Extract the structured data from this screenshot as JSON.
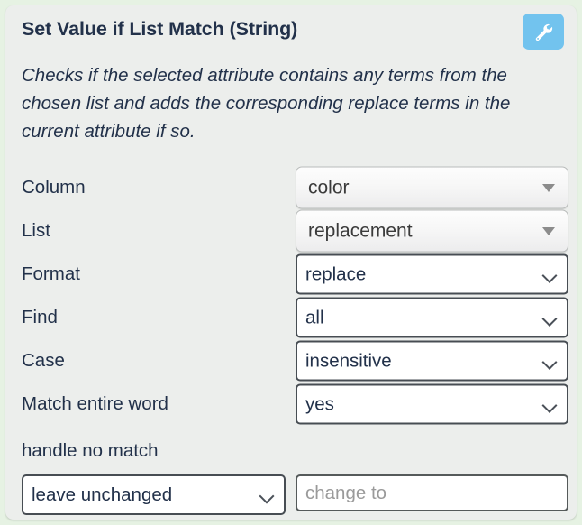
{
  "card": {
    "title": "Set Value if List Match (String)",
    "description": "Checks if the selected attribute contains any terms from the chosen list and adds the corresponding replace terms in the current attribute if so.",
    "badge_icon": "wrench-icon",
    "accent_color": "#72c3ee",
    "background_color": "#eceeec",
    "page_background_color": "#e6f2e3",
    "text_color": "#22314a"
  },
  "form": {
    "rows": [
      {
        "label": "Column",
        "value": "color",
        "control": "combo",
        "icon": "triangle-down-icon"
      },
      {
        "label": "List",
        "value": "replacement",
        "control": "combo",
        "icon": "triangle-down-icon"
      },
      {
        "label": "Format",
        "value": "replace",
        "control": "select",
        "icon": "chevron-down-icon"
      },
      {
        "label": "Find",
        "value": "all",
        "control": "select",
        "icon": "chevron-down-icon"
      },
      {
        "label": "Case",
        "value": "insensitive",
        "control": "select",
        "icon": "chevron-down-icon"
      },
      {
        "label": "Match entire word",
        "value": "yes",
        "control": "select",
        "icon": "chevron-down-icon"
      }
    ]
  },
  "no_match": {
    "label": "handle no match",
    "action_value": "leave unchanged",
    "action_icon": "chevron-down-icon",
    "change_to_value": "",
    "change_to_placeholder": "change to"
  }
}
